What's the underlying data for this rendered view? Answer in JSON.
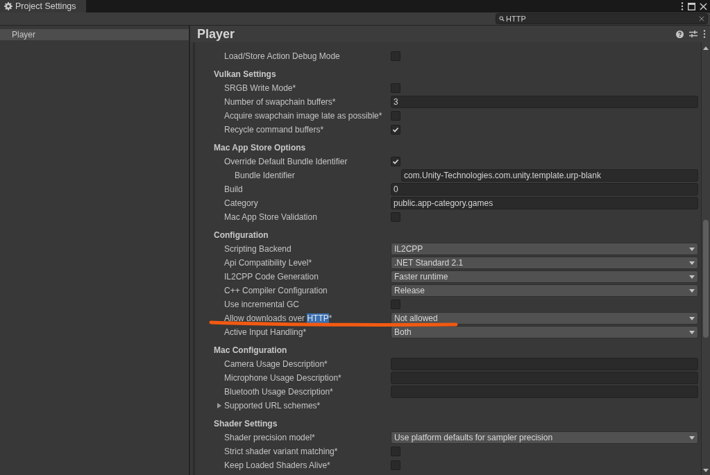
{
  "window": {
    "tab_title": "Project Settings"
  },
  "search": {
    "value": "HTTP"
  },
  "sidebar": {
    "items": [
      {
        "label": "Player",
        "selected": true
      }
    ]
  },
  "panel": {
    "title": "Player"
  },
  "sections": [
    {
      "items": [
        {
          "kind": "checkbox",
          "label": "Load/Store Action Debug Mode",
          "checked": false
        }
      ]
    },
    {
      "title": "Vulkan Settings",
      "items": [
        {
          "kind": "checkbox",
          "label": "SRGB Write Mode*",
          "checked": false
        },
        {
          "kind": "text",
          "label": "Number of swapchain buffers*",
          "value": "3"
        },
        {
          "kind": "checkbox",
          "label": "Acquire swapchain image late as possible*",
          "checked": false
        },
        {
          "kind": "checkbox",
          "label": "Recycle command buffers*",
          "checked": true
        }
      ]
    },
    {
      "title": "Mac App Store Options",
      "items": [
        {
          "kind": "checkbox",
          "label": "Override Default Bundle Identifier",
          "checked": true,
          "children": [
            {
              "kind": "text",
              "label": "Bundle Identifier",
              "value": "com.Unity-Technologies.com.unity.template.urp-blank"
            }
          ]
        },
        {
          "kind": "text",
          "label": "Build",
          "value": "0"
        },
        {
          "kind": "text",
          "label": "Category",
          "value": "public.app-category.games"
        },
        {
          "kind": "checkbox",
          "label": "Mac App Store Validation",
          "checked": false
        }
      ]
    },
    {
      "title": "Configuration",
      "items": [
        {
          "kind": "dropdown",
          "label": "Scripting Backend",
          "value": "IL2CPP"
        },
        {
          "kind": "dropdown",
          "label": "Api Compatibility Level*",
          "value": ".NET Standard 2.1"
        },
        {
          "kind": "dropdown",
          "label": "IL2CPP Code Generation",
          "value": "Faster runtime"
        },
        {
          "kind": "dropdown",
          "label": "C++ Compiler Configuration",
          "value": "Release"
        },
        {
          "kind": "checkbox",
          "label": "Use incremental GC",
          "checked": false
        },
        {
          "kind": "dropdown",
          "label_parts": [
            {
              "text": "Allow downloads over ",
              "highlighted": false
            },
            {
              "text": "HTTP",
              "highlighted": true
            },
            {
              "text": "*",
              "highlighted": false
            }
          ],
          "value": "Not allowed"
        },
        {
          "kind": "dropdown",
          "label": "Active Input Handling*",
          "value": "Both"
        }
      ]
    },
    {
      "title": "Mac Configuration",
      "items": [
        {
          "kind": "text",
          "label": "Camera Usage Description*",
          "value": ""
        },
        {
          "kind": "text",
          "label": "Microphone Usage Description*",
          "value": ""
        },
        {
          "kind": "text",
          "label": "Bluetooth Usage Description*",
          "value": ""
        },
        {
          "kind": "foldout",
          "label": "Supported URL schemes*",
          "expanded": false
        }
      ]
    },
    {
      "title": "Shader Settings",
      "items": [
        {
          "kind": "dropdown",
          "label": "Shader precision model*",
          "value": "Use platform defaults for sampler precision"
        },
        {
          "kind": "checkbox",
          "label": "Strict shader variant matching*",
          "checked": false
        },
        {
          "kind": "checkbox",
          "label": "Keep Loaded Shaders Alive*",
          "checked": false
        }
      ]
    }
  ]
}
